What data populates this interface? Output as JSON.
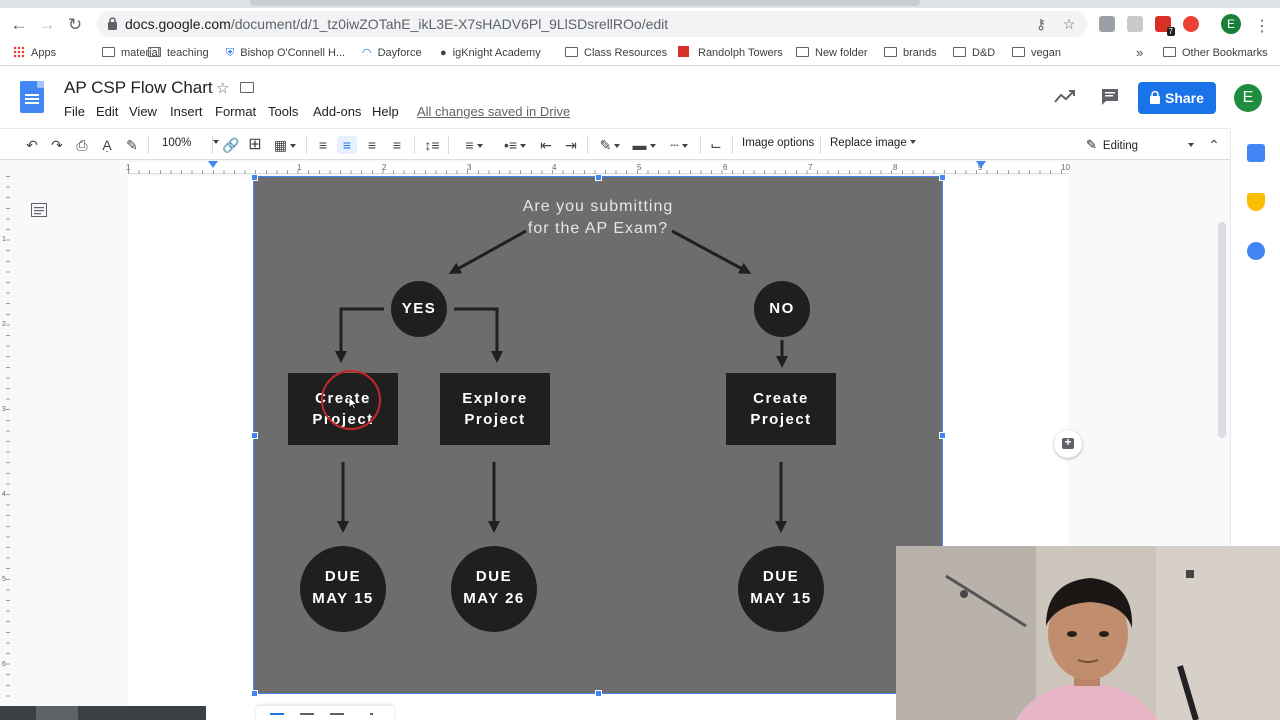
{
  "browser": {
    "url_host": "docs.google.com",
    "url_path": "/document/d/1_tz0iwZOTahE_ikL3E-X7sHADV6Pl_9LlSDsrellROo/edit",
    "avatar_letter": "E",
    "ext_badge": "7"
  },
  "bookmarks": [
    {
      "label": "Apps"
    },
    {
      "label": "material"
    },
    {
      "label": "teaching"
    },
    {
      "label": "Bishop O'Connell H..."
    },
    {
      "label": "Dayforce"
    },
    {
      "label": "igKnight Academy"
    },
    {
      "label": "Class Resources"
    },
    {
      "label": "Randolph Towers"
    },
    {
      "label": "New folder"
    },
    {
      "label": "brands"
    },
    {
      "label": "D&D"
    },
    {
      "label": "vegan"
    }
  ],
  "bookmarks_more": "»",
  "other_bookmarks": "Other Bookmarks",
  "doc": {
    "title": "AP CSP Flow Chart",
    "saved_status": "All changes saved in Drive",
    "share_label": "Share",
    "user_initial": "E"
  },
  "menu": [
    "File",
    "Edit",
    "View",
    "Insert",
    "Format",
    "Tools",
    "Add-ons",
    "Help"
  ],
  "toolbar": {
    "zoom": "100%",
    "image_options": "Image options",
    "replace_image": "Replace image",
    "mode": "Editing"
  },
  "ruler_numbers": [
    "1",
    "1",
    "2",
    "3",
    "4",
    "5",
    "6",
    "7",
    "8",
    "9",
    "10"
  ],
  "vruler_numbers": [
    "1",
    "2",
    "3",
    "4",
    "5",
    "6"
  ],
  "flowchart": {
    "question": "Are you submitting for the AP Exam?",
    "yes": "YES",
    "no": "NO",
    "box1": {
      "l1": "Create",
      "l2": "Project"
    },
    "box2": {
      "l1": "Explore",
      "l2": "Project"
    },
    "box3": {
      "l1": "Create",
      "l2": "Project"
    },
    "due1": {
      "l1": "DUE",
      "l2": "MAY 15"
    },
    "due2": {
      "l1": "DUE",
      "l2": "MAY 26"
    },
    "due3": {
      "l1": "DUE",
      "l2": "MAY 15"
    }
  },
  "colors": {
    "accent": "#1a73e8",
    "image_bg": "#6d6d6d",
    "node_fill": "#1f1f1f"
  }
}
